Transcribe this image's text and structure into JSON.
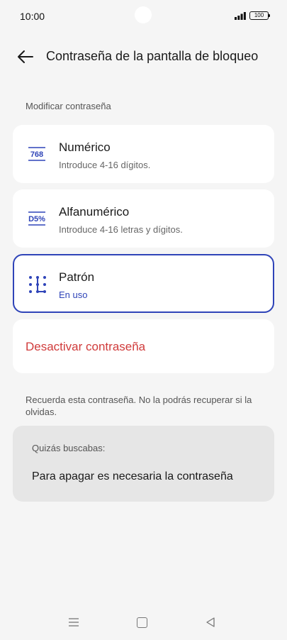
{
  "status_bar": {
    "time": "10:00",
    "battery": "100"
  },
  "header": {
    "title": "Contraseña de la pantalla de bloqueo"
  },
  "section": {
    "label": "Modificar contraseña"
  },
  "options": [
    {
      "icon": "numeric-768-icon",
      "icon_text": "768",
      "title": "Numérico",
      "subtitle": "Introduce 4-16 dígitos."
    },
    {
      "icon": "alphanumeric-d5-icon",
      "icon_text": "D5%",
      "title": "Alfanumérico",
      "subtitle": "Introduce 4-16 letras y dígitos."
    },
    {
      "icon": "pattern-icon",
      "title": "Patrón",
      "subtitle": "En uso",
      "selected": true
    }
  ],
  "disable": {
    "label": "Desactivar contraseña"
  },
  "warning": {
    "text": "Recuerda esta contraseña. No la podrás recuperar si la olvidas."
  },
  "suggestion": {
    "label": "Quizás buscabas:",
    "link": "Para apagar es necesaria la contraseña"
  },
  "colors": {
    "accent": "#2f44b8",
    "danger": "#d03b3b",
    "background": "#f5f5f5"
  }
}
